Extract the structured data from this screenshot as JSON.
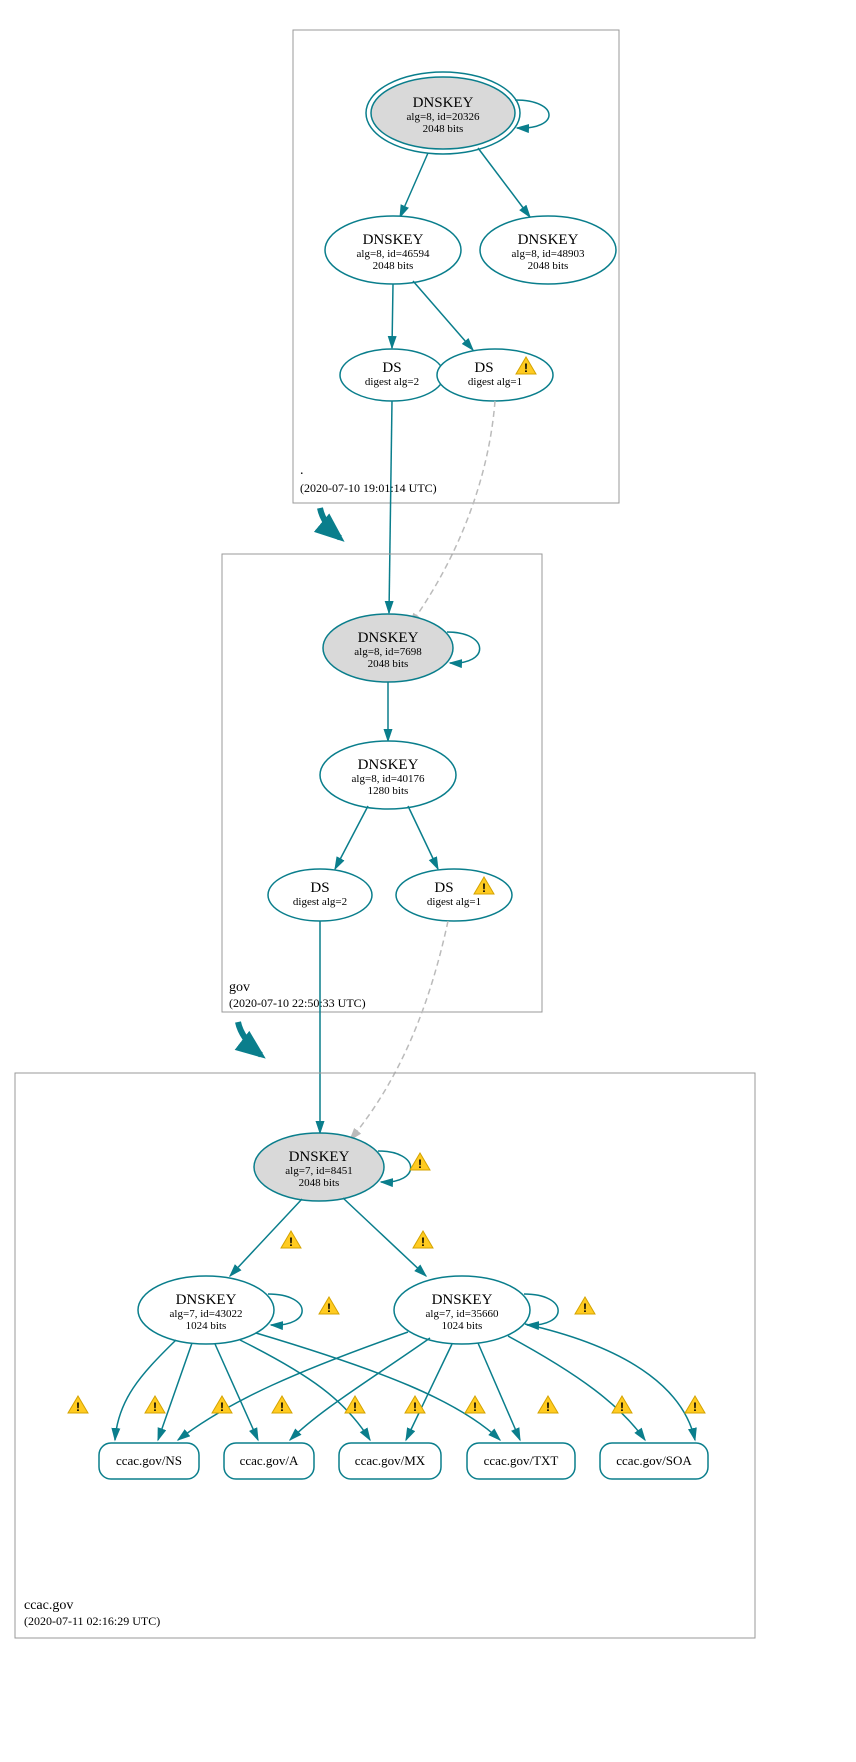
{
  "zones": [
    {
      "name": ".",
      "timestamp": "(2020-07-10 19:01:14 UTC)"
    },
    {
      "name": "gov",
      "timestamp": "(2020-07-10 22:50:33 UTC)"
    },
    {
      "name": "ccac.gov",
      "timestamp": "(2020-07-11 02:16:29 UTC)"
    }
  ],
  "nodes": {
    "root_ksk": {
      "l1": "DNSKEY",
      "l2": "alg=8, id=20326",
      "l3": "2048 bits"
    },
    "root_zsk1": {
      "l1": "DNSKEY",
      "l2": "alg=8, id=46594",
      "l3": "2048 bits"
    },
    "root_zsk2": {
      "l1": "DNSKEY",
      "l2": "alg=8, id=48903",
      "l3": "2048 bits"
    },
    "root_ds1": {
      "l1": "DS",
      "l2": "digest alg=2"
    },
    "root_ds2": {
      "l1": "DS",
      "l2": "digest alg=1"
    },
    "gov_ksk": {
      "l1": "DNSKEY",
      "l2": "alg=8, id=7698",
      "l3": "2048 bits"
    },
    "gov_zsk": {
      "l1": "DNSKEY",
      "l2": "alg=8, id=40176",
      "l3": "1280 bits"
    },
    "gov_ds1": {
      "l1": "DS",
      "l2": "digest alg=2"
    },
    "gov_ds2": {
      "l1": "DS",
      "l2": "digest alg=1"
    },
    "ccac_ksk": {
      "l1": "DNSKEY",
      "l2": "alg=7, id=8451",
      "l3": "2048 bits"
    },
    "ccac_zsk1": {
      "l1": "DNSKEY",
      "l2": "alg=7, id=43022",
      "l3": "1024 bits"
    },
    "ccac_zsk2": {
      "l1": "DNSKEY",
      "l2": "alg=7, id=35660",
      "l3": "1024 bits"
    }
  },
  "rr": [
    "ccac.gov/NS",
    "ccac.gov/A",
    "ccac.gov/MX",
    "ccac.gov/TXT",
    "ccac.gov/SOA"
  ]
}
